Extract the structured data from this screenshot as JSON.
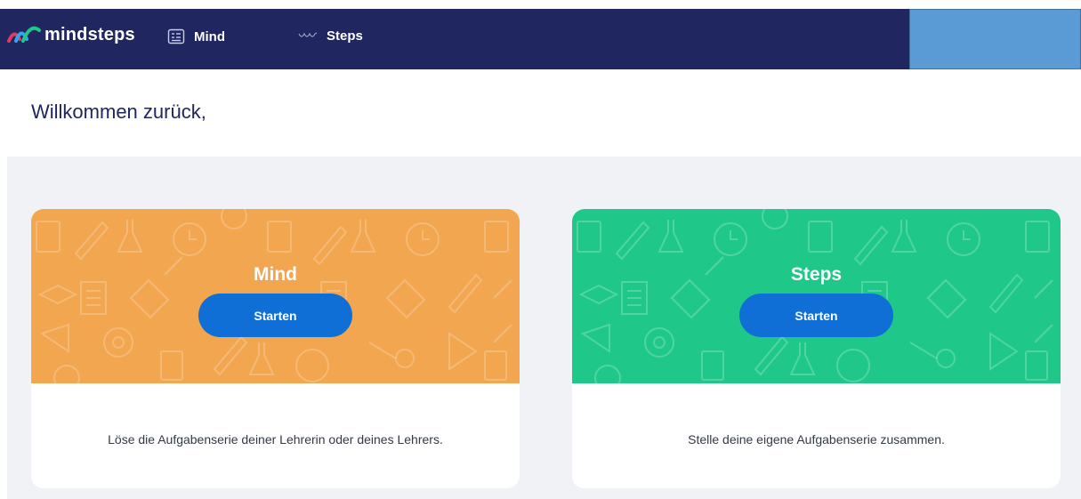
{
  "header": {
    "logo_text": "mindsteps",
    "nav": [
      {
        "label": "Mind",
        "icon": "checklist-icon"
      },
      {
        "label": "Steps",
        "icon": "footsteps-icon"
      }
    ]
  },
  "welcome": {
    "text": "Willkommen zurück,"
  },
  "cards": [
    {
      "title": "Mind",
      "button_label": "Starten",
      "description": "Löse die Aufgabenserie deiner Lehrerin oder deines Lehrers.",
      "color": "#f2a650"
    },
    {
      "title": "Steps",
      "button_label": "Starten",
      "description": "Stelle deine eigene Aufgabenserie zusammen.",
      "color": "#1fc889"
    }
  ],
  "colors": {
    "header_bg": "#1f2660",
    "button": "#0f6fd6",
    "user_box": "#5b9bd5",
    "content_bg": "#f1f2f5"
  }
}
